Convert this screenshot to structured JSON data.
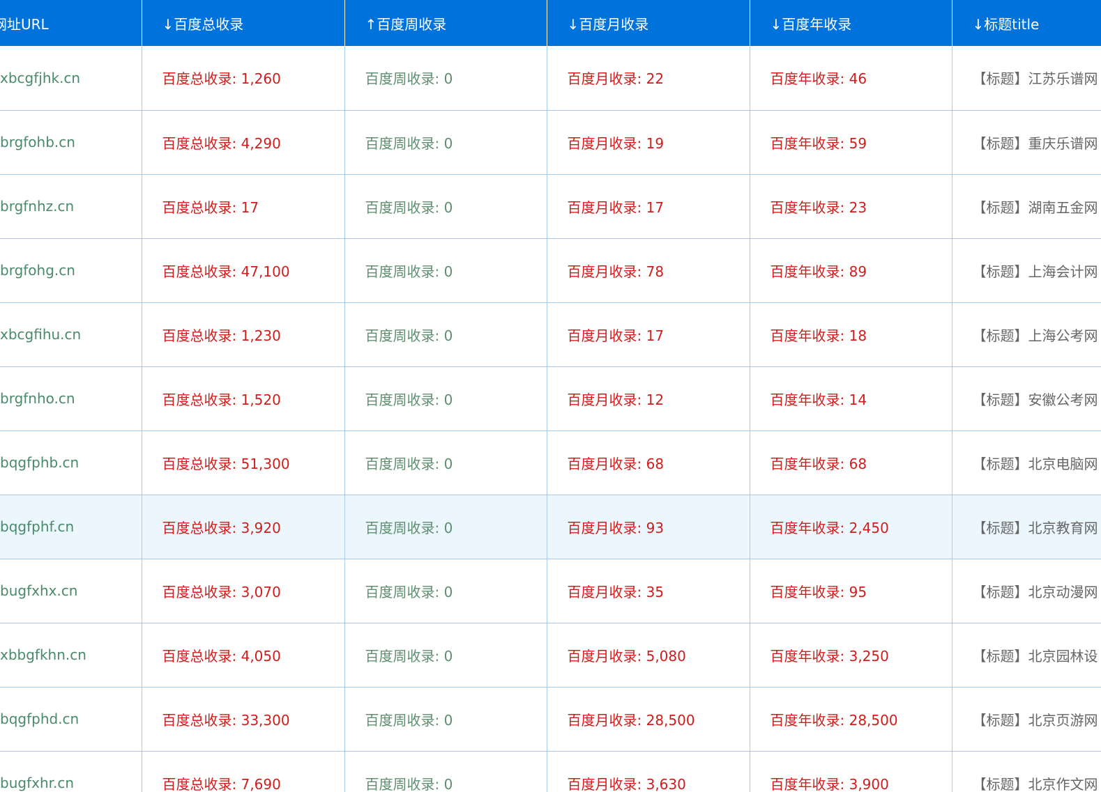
{
  "table": {
    "headers": {
      "url": "网址URL",
      "total": "↓百度总收录",
      "week": "↑百度周收录",
      "month": "↓百度月收录",
      "year": "↓百度年收录",
      "title": "↓标题title"
    },
    "rows": [
      {
        "url": "xbcgfjhk.cn",
        "total": "百度总收录: 1,260",
        "week": "百度周收录: 0",
        "month": "百度月收录: 22",
        "year": "百度年收录: 46",
        "title": "【标题】江苏乐谱网"
      },
      {
        "url": "brgfohb.cn",
        "total": "百度总收录: 4,290",
        "week": "百度周收录: 0",
        "month": "百度月收录: 19",
        "year": "百度年收录: 59",
        "title": "【标题】重庆乐谱网"
      },
      {
        "url": "brgfnhz.cn",
        "total": "百度总收录: 17",
        "week": "百度周收录: 0",
        "month": "百度月收录: 17",
        "year": "百度年收录: 23",
        "title": "【标题】湖南五金网"
      },
      {
        "url": "brgfohg.cn",
        "total": "百度总收录: 47,100",
        "week": "百度周收录: 0",
        "month": "百度月收录: 78",
        "year": "百度年收录: 89",
        "title": "【标题】上海会计网"
      },
      {
        "url": "xbcgfihu.cn",
        "total": "百度总收录: 1,230",
        "week": "百度周收录: 0",
        "month": "百度月收录: 17",
        "year": "百度年收录: 18",
        "title": "【标题】上海公考网"
      },
      {
        "url": "brgfnho.cn",
        "total": "百度总收录: 1,520",
        "week": "百度周收录: 0",
        "month": "百度月收录: 12",
        "year": "百度年收录: 14",
        "title": "【标题】安徽公考网"
      },
      {
        "url": "bqgfphb.cn",
        "total": "百度总收录: 51,300",
        "week": "百度周收录: 0",
        "month": "百度月收录: 68",
        "year": "百度年收录: 68",
        "title": "【标题】北京电脑网"
      },
      {
        "url": "bqgfphf.cn",
        "total": "百度总收录: 3,920",
        "week": "百度周收录: 0",
        "month": "百度月收录: 93",
        "year": "百度年收录: 2,450",
        "title": "【标题】北京教育网"
      },
      {
        "url": "bugfxhx.cn",
        "total": "百度总收录: 3,070",
        "week": "百度周收录: 0",
        "month": "百度月收录: 35",
        "year": "百度年收录: 95",
        "title": "【标题】北京动漫网"
      },
      {
        "url": "xbbgfkhn.cn",
        "total": "百度总收录: 4,050",
        "week": "百度周收录: 0",
        "month": "百度月收录: 5,080",
        "year": "百度年收录: 3,250",
        "title": "【标题】北京园林设"
      },
      {
        "url": "bqgfphd.cn",
        "total": "百度总收录: 33,300",
        "week": "百度周收录: 0",
        "month": "百度月收录: 28,500",
        "year": "百度年收录: 28,500",
        "title": "【标题】北京页游网"
      },
      {
        "url": "bugfxhr.cn",
        "total": "百度总收录: 7,690",
        "week": "百度周收录: 0",
        "month": "百度月收录: 3,630",
        "year": "百度年收录: 3,900",
        "title": "【标题】北京作文网"
      }
    ]
  },
  "colors": {
    "header_bg": "#0072dc",
    "header_text": "#ffffff",
    "url_text": "#4a8a6a",
    "red_text": "#d21c1c",
    "green_text": "#5f8e6f",
    "title_text": "#666666",
    "border": "#a9cbe8",
    "highlight_row": "#ebf7fc"
  }
}
